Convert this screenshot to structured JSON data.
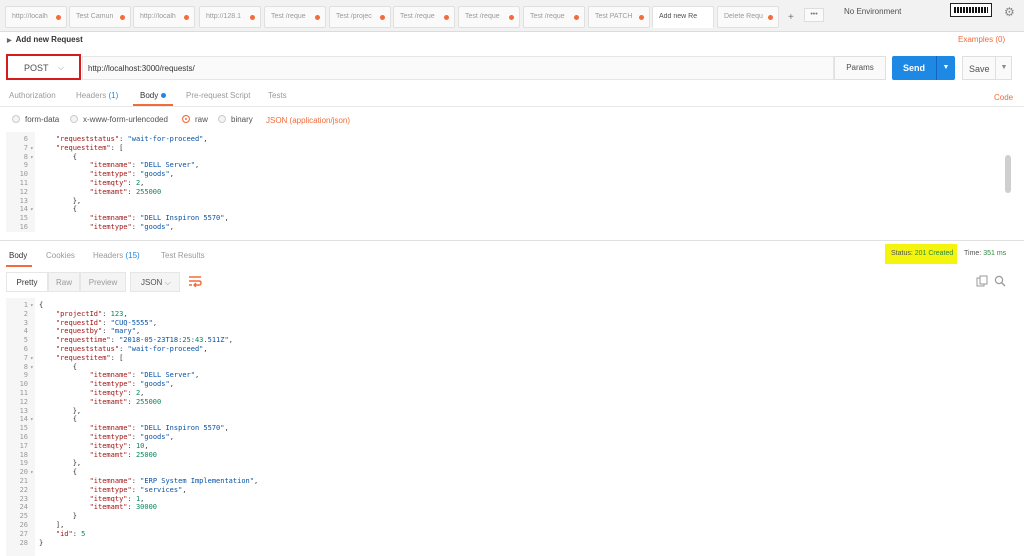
{
  "tabs": [
    {
      "label": "http://localh",
      "dirty": true,
      "active": false
    },
    {
      "label": "Test Camun",
      "dirty": true,
      "active": false
    },
    {
      "label": "http://localh",
      "dirty": true,
      "active": false
    },
    {
      "label": "http://128.1",
      "dirty": true,
      "active": false
    },
    {
      "label": "Test /reque",
      "dirty": true,
      "active": false
    },
    {
      "label": "Test /projec",
      "dirty": true,
      "active": false
    },
    {
      "label": "Test /reque",
      "dirty": true,
      "active": false
    },
    {
      "label": "Test /reque",
      "dirty": true,
      "active": false
    },
    {
      "label": "Test /reque",
      "dirty": true,
      "active": false
    },
    {
      "label": "Test PATCH",
      "dirty": true,
      "active": false
    },
    {
      "label": "Add new Re",
      "dirty": false,
      "active": true
    },
    {
      "label": "Delete Requ",
      "dirty": true,
      "active": false
    }
  ],
  "tab_add": "+",
  "tab_more": "•••",
  "environment": "No Environment",
  "request_name": "Add new Request",
  "examples": "Examples (0)",
  "method": "POST",
  "url": "http://localhost:3000/requests/",
  "params_label": "Params",
  "send_label": "Send",
  "save_label": "Save",
  "request_tabs": {
    "authorization": "Authorization",
    "headers": "Headers",
    "headers_count": "(1)",
    "body": "Body",
    "prerequest": "Pre-request Script",
    "tests": "Tests"
  },
  "code_label": "Code",
  "body_types": {
    "form_data": "form-data",
    "urlencoded": "x-www-form-urlencoded",
    "raw": "raw",
    "binary": "binary"
  },
  "json_select": "JSON (application/json)",
  "request_body_lines": [
    {
      "n": "6",
      "fold": "",
      "text": "    \"requeststatus\": \"wait-for-proceed\","
    },
    {
      "n": "7",
      "fold": "▾",
      "text": "    \"requestitem\": ["
    },
    {
      "n": "8",
      "fold": "▾",
      "text": "        {"
    },
    {
      "n": "9",
      "fold": "",
      "text": "            \"itemname\": \"DELL Server\","
    },
    {
      "n": "10",
      "fold": "",
      "text": "            \"itemtype\": \"goods\","
    },
    {
      "n": "11",
      "fold": "",
      "text": "            \"itemqty\": 2,"
    },
    {
      "n": "12",
      "fold": "",
      "text": "            \"itemamt\": 255000"
    },
    {
      "n": "13",
      "fold": "",
      "text": "        },"
    },
    {
      "n": "14",
      "fold": "▾",
      "text": "        {"
    },
    {
      "n": "15",
      "fold": "",
      "text": "            \"itemname\": \"DELL Inspiron 5570\","
    },
    {
      "n": "16",
      "fold": "",
      "text": "            \"itemtype\": \"goods\","
    }
  ],
  "response_tabs": {
    "body": "Body",
    "cookies": "Cookies",
    "headers": "Headers",
    "headers_count": "(15)",
    "test_results": "Test Results"
  },
  "status_label": "Status:",
  "status_value": "201 Created",
  "time_label": "Time:",
  "time_value": "351 ms",
  "format_buttons": {
    "pretty": "Pretty",
    "raw": "Raw",
    "preview": "Preview"
  },
  "response_format": "JSON",
  "response_lines": [
    {
      "n": "1",
      "fold": "▾",
      "text": "{"
    },
    {
      "n": "2",
      "fold": "",
      "text": "    \"projectId\": 123,"
    },
    {
      "n": "3",
      "fold": "",
      "text": "    \"requestId\": \"CUQ-5555\","
    },
    {
      "n": "4",
      "fold": "",
      "text": "    \"requestby\": \"mary\","
    },
    {
      "n": "5",
      "fold": "",
      "text": "    \"requesttime\": \"2018-05-23T18:25:43.511Z\","
    },
    {
      "n": "6",
      "fold": "",
      "text": "    \"requeststatus\": \"wait-for-proceed\","
    },
    {
      "n": "7",
      "fold": "▾",
      "text": "    \"requestitem\": ["
    },
    {
      "n": "8",
      "fold": "▾",
      "text": "        {"
    },
    {
      "n": "9",
      "fold": "",
      "text": "            \"itemname\": \"DELL Server\","
    },
    {
      "n": "10",
      "fold": "",
      "text": "            \"itemtype\": \"goods\","
    },
    {
      "n": "11",
      "fold": "",
      "text": "            \"itemqty\": 2,"
    },
    {
      "n": "12",
      "fold": "",
      "text": "            \"itemamt\": 255000"
    },
    {
      "n": "13",
      "fold": "",
      "text": "        },"
    },
    {
      "n": "14",
      "fold": "▾",
      "text": "        {"
    },
    {
      "n": "15",
      "fold": "",
      "text": "            \"itemname\": \"DELL Inspiron 5570\","
    },
    {
      "n": "16",
      "fold": "",
      "text": "            \"itemtype\": \"goods\","
    },
    {
      "n": "17",
      "fold": "",
      "text": "            \"itemqty\": 10,"
    },
    {
      "n": "18",
      "fold": "",
      "text": "            \"itemamt\": 25000"
    },
    {
      "n": "19",
      "fold": "",
      "text": "        },"
    },
    {
      "n": "20",
      "fold": "▾",
      "text": "        {"
    },
    {
      "n": "21",
      "fold": "",
      "text": "            \"itemname\": \"ERP System Implementation\","
    },
    {
      "n": "22",
      "fold": "",
      "text": "            \"itemtype\": \"services\","
    },
    {
      "n": "23",
      "fold": "",
      "text": "            \"itemqty\": 1,"
    },
    {
      "n": "24",
      "fold": "",
      "text": "            \"itemamt\": 30000"
    },
    {
      "n": "25",
      "fold": "",
      "text": "        }"
    },
    {
      "n": "26",
      "fold": "",
      "text": "    ],"
    },
    {
      "n": "27",
      "fold": "",
      "text": "    \"id\": 5"
    },
    {
      "n": "28",
      "fold": "",
      "text": "}"
    }
  ],
  "colors": {
    "accent": "#f26b3a",
    "send": "#1e88e5",
    "method_highlight": "#d51b1b",
    "status_highlight": "#f4f40f",
    "status_ok": "#2e8b3a"
  }
}
